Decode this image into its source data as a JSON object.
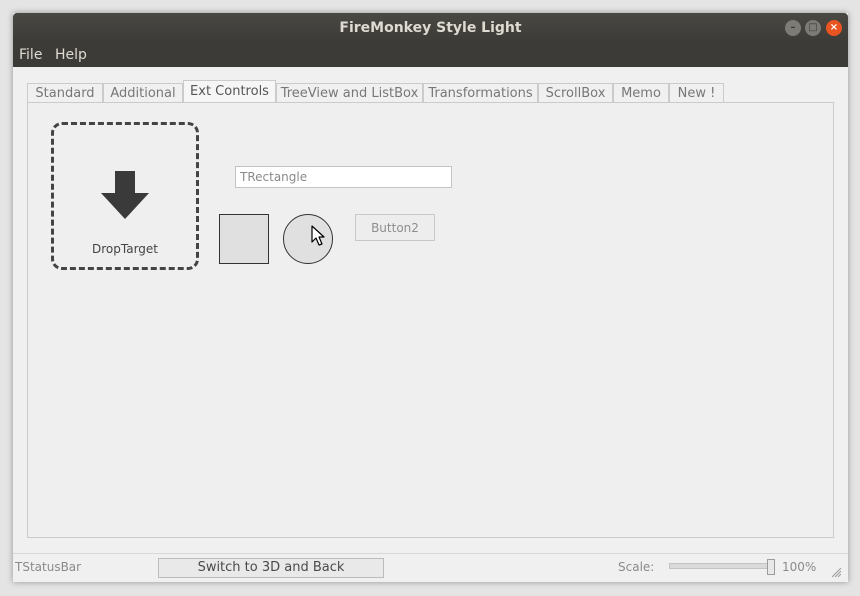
{
  "window": {
    "title": "FireMonkey Style Light"
  },
  "titlebar_buttons": {
    "minimize": "–",
    "maximize": "□",
    "close": "×"
  },
  "menu": {
    "items": [
      {
        "label": "File"
      },
      {
        "label": "Help"
      }
    ]
  },
  "tabs": [
    {
      "label": "Standard",
      "active": false
    },
    {
      "label": "Additional",
      "active": false
    },
    {
      "label": "Ext Controls",
      "active": true
    },
    {
      "label": "TreeView and ListBox",
      "active": false
    },
    {
      "label": "Transformations",
      "active": false
    },
    {
      "label": "ScrollBox",
      "active": false
    },
    {
      "label": "Memo",
      "active": false
    },
    {
      "label": "New !",
      "active": false
    }
  ],
  "content": {
    "drop_target_label": "DropTarget",
    "edit_value": "TRectangle",
    "button2_label": "Button2"
  },
  "statusbar": {
    "label": "TStatusBar",
    "switch_button": "Switch to 3D and Back",
    "scale_label": "Scale:",
    "scale_value": "100%",
    "scale_fraction": 1.0
  },
  "colors": {
    "titlebar": "#3c3b37",
    "close_button": "#e95420",
    "window_bg": "#f0f0f0"
  },
  "icons": {
    "drop_arrow": "down-arrow-icon",
    "cursor": "mouse-pointer-icon",
    "size_grip": "resize-grip-icon"
  }
}
